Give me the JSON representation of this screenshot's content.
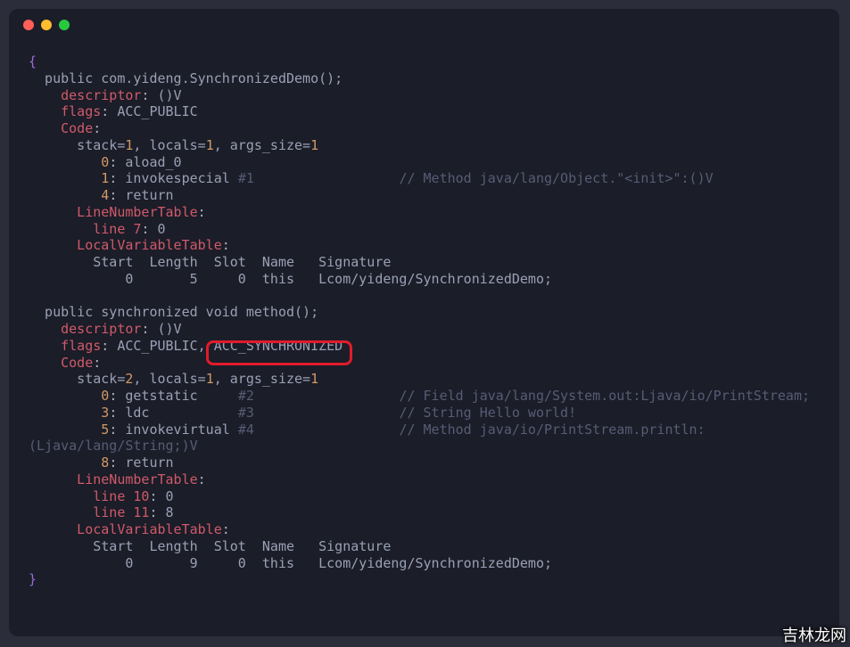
{
  "code": {
    "brace_open": "{",
    "line1_a": "  public com.yideng.SynchronizedDemo();",
    "desc1_k": "    descriptor",
    "desc1_c": ":",
    "desc1_v": " ()V",
    "flags1_k": "    flags",
    "flags1_c": ":",
    "flags1_v": " ACC_PUBLIC",
    "code1_k": "    Code",
    "code1_c": ":",
    "stack1_a": "      stack=",
    "stack1_n1": "1",
    "stack1_b": ", locals=",
    "stack1_n2": "1",
    "stack1_c": ", args_size=",
    "stack1_n3": "1",
    "i1a_pad": "         ",
    "i1a_n": "0",
    "i1a_c": ":",
    "i1a_t": " aload_0",
    "i1b_pad": "         ",
    "i1b_n": "1",
    "i1b_c": ":",
    "i1b_t": " invokespecial ",
    "i1b_ref": "#1",
    "i1b_sp": "                  ",
    "i1b_cm": "// Method java/lang/Object.\"<init>\":()V",
    "i1c_pad": "         ",
    "i1c_n": "4",
    "i1c_c": ":",
    "i1c_t": " return",
    "lnt1_k": "      LineNumberTable",
    "lnt1_c": ":",
    "lnt1a_k": "        line 7",
    "lnt1a_c": ":",
    "lnt1a_v": " 0",
    "lvt1_k": "      LocalVariableTable",
    "lvt1_c": ":",
    "lvt1_h": "        Start  Length  Slot  Name   Signature",
    "lvt1_r": "            0       5     0  this   Lcom/yideng/SynchronizedDemo;",
    "blank": "",
    "line2_a": "  public synchronized void method();",
    "desc2_k": "    descriptor",
    "desc2_c": ":",
    "desc2_v": " ()V",
    "flags2_k": "    flags",
    "flags2_c": ":",
    "flags2_v": " ACC_PUBLIC, ACC_SYNCHRONIZED",
    "code2_k": "    Code",
    "code2_c": ":",
    "stack2_a": "      stack=",
    "stack2_n1": "2",
    "stack2_b": ", locals=",
    "stack2_n2": "1",
    "stack2_c": ", args_size=",
    "stack2_n3": "1",
    "i2a_pad": "         ",
    "i2a_n": "0",
    "i2a_c": ":",
    "i2a_t": " getstatic     ",
    "i2a_ref": "#2",
    "i2a_sp": "                  ",
    "i2a_cm": "// Field java/lang/System.out:Ljava/io/PrintStream;",
    "i2b_pad": "         ",
    "i2b_n": "3",
    "i2b_c": ":",
    "i2b_t": " ldc           ",
    "i2b_ref": "#3",
    "i2b_sp": "                  ",
    "i2b_cm": "// String Hello world!",
    "i2c_pad": "         ",
    "i2c_n": "5",
    "i2c_c": ":",
    "i2c_t": " invokevirtual ",
    "i2c_ref": "#4",
    "i2c_sp": "                  ",
    "i2c_cm": "// Method java/io/PrintStream.println:",
    "i2c_cm2": "(Ljava/lang/String;)V",
    "i2d_pad": "         ",
    "i2d_n": "8",
    "i2d_c": ":",
    "i2d_t": " return",
    "lnt2_k": "      LineNumberTable",
    "lnt2_c": ":",
    "lnt2a_k": "        line 10",
    "lnt2a_c": ":",
    "lnt2a_v": " 0",
    "lnt2b_k": "        line 11",
    "lnt2b_c": ":",
    "lnt2b_v": " 8",
    "lvt2_k": "      LocalVariableTable",
    "lvt2_c": ":",
    "lvt2_h": "        Start  Length  Slot  Name   Signature",
    "lvt2_r": "            0       9     0  this   Lcom/yideng/SynchronizedDemo;",
    "brace_close": "}"
  },
  "watermark": "吉林龙网"
}
